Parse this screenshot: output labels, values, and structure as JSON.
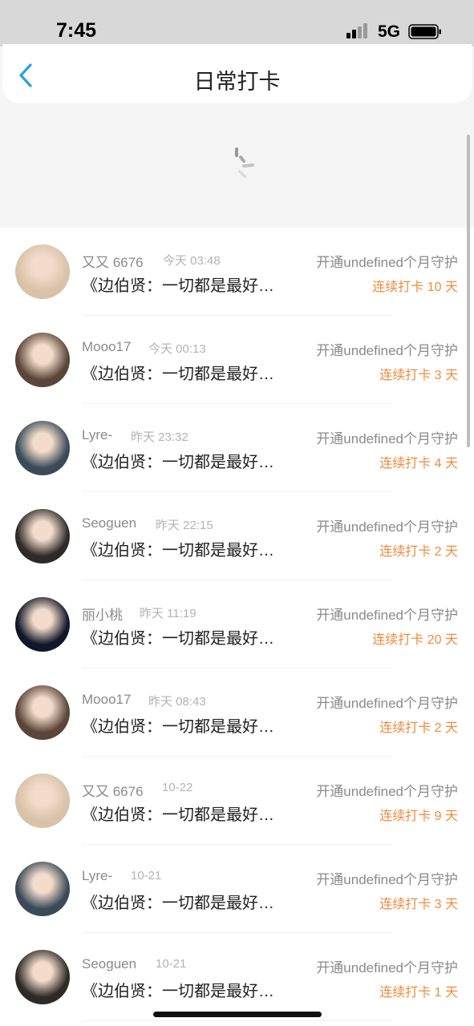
{
  "status_bar": {
    "time": "7:45",
    "network": "5G"
  },
  "header": {
    "title": "日常打卡"
  },
  "list": [
    {
      "name": "又又 6676",
      "time": "今天 03:48",
      "guard": "开通undefined个月守护",
      "post": "《边伯贤：一切都是最好…",
      "streak": "连续打卡 10 天",
      "avatar_color": "#d9c2a8"
    },
    {
      "name": "Mooo17",
      "time": "今天 00:13",
      "guard": "开通undefined个月守护",
      "post": "《边伯贤：一切都是最好…",
      "streak": "连续打卡 3 天",
      "avatar_color": "#5a4538"
    },
    {
      "name": "Lyre-",
      "time": "昨天 23:32",
      "guard": "开通undefined个月守护",
      "post": "《边伯贤：一切都是最好…",
      "streak": "连续打卡 4 天",
      "avatar_color": "#3a4a58"
    },
    {
      "name": "Seoguen",
      "time": "昨天 22:15",
      "guard": "开通undefined个月守护",
      "post": "《边伯贤：一切都是最好…",
      "streak": "连续打卡 2 天",
      "avatar_color": "#2e2a28"
    },
    {
      "name": "丽小桃",
      "time": "昨天 11:19",
      "guard": "开通undefined个月守护",
      "post": "《边伯贤：一切都是最好…",
      "streak": "连续打卡 20 天",
      "avatar_color": "#10172a"
    },
    {
      "name": "Mooo17",
      "time": "昨天 08:43",
      "guard": "开通undefined个月守护",
      "post": "《边伯贤：一切都是最好…",
      "streak": "连续打卡 2 天",
      "avatar_color": "#5a4538"
    },
    {
      "name": "又又 6676",
      "time": "10-22",
      "guard": "开通undefined个月守护",
      "post": "《边伯贤：一切都是最好…",
      "streak": "连续打卡 9 天",
      "avatar_color": "#d9c2a8"
    },
    {
      "name": "Lyre-",
      "time": "10-21",
      "guard": "开通undefined个月守护",
      "post": "《边伯贤：一切都是最好…",
      "streak": "连续打卡 3 天",
      "avatar_color": "#3a4a58"
    },
    {
      "name": "Seoguen",
      "time": "10-21",
      "guard": "开通undefined个月守护",
      "post": "《边伯贤：一切都是最好…",
      "streak": "连续打卡 1 天",
      "avatar_color": "#2e2a28"
    }
  ],
  "colors": {
    "accent": "#29a0e0",
    "streak": "#f08a3c"
  }
}
